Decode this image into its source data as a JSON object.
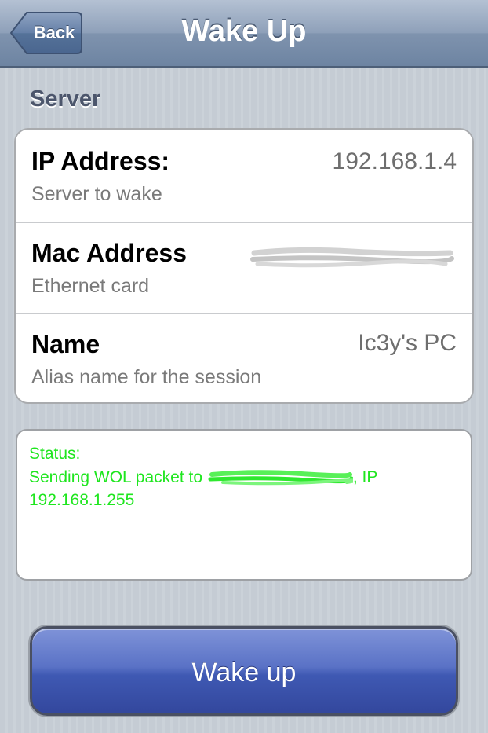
{
  "navbar": {
    "title": "Wake Up",
    "back_label": "Back"
  },
  "section": {
    "header": "Server"
  },
  "rows": [
    {
      "title": "IP Address:",
      "subtitle": "Server to wake",
      "value": "192.168.1.4"
    },
    {
      "title": "Mac Address",
      "subtitle": "Ethernet card",
      "value": ""
    },
    {
      "title": "Name",
      "subtitle": "Alias name for the session",
      "value": "Ic3y's PC"
    }
  ],
  "status": {
    "label": "Status:",
    "line_prefix": "Sending WOL packet to",
    "line_suffix": ", IP",
    "broadcast_ip": "192.168.1.255",
    "text_color": "#1ee61e"
  },
  "wake_button": {
    "label": "Wake up",
    "color": "#4a62bd"
  },
  "icons": {
    "back": "back-arrow-shape"
  }
}
